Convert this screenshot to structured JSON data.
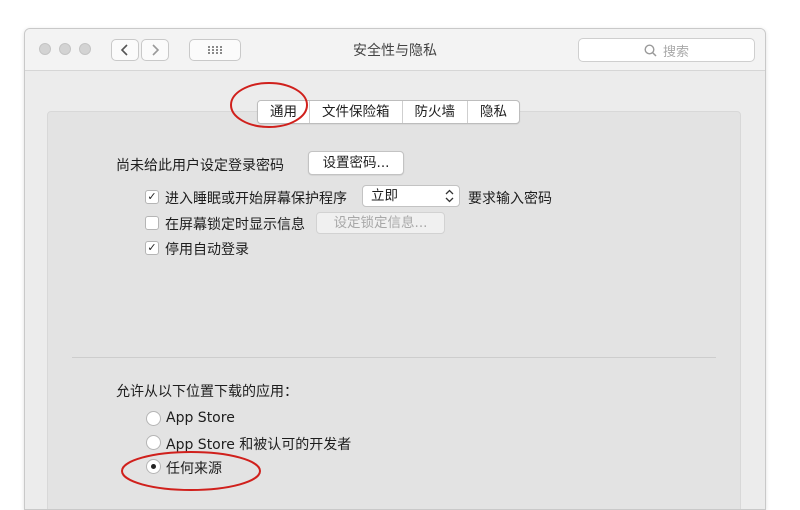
{
  "window": {
    "title": "安全性与隐私"
  },
  "search": {
    "placeholder": "搜索"
  },
  "tabs": [
    {
      "label": "通用",
      "selected": true
    },
    {
      "label": "文件保险箱",
      "selected": false
    },
    {
      "label": "防火墙",
      "selected": false
    },
    {
      "label": "隐私",
      "selected": false
    }
  ],
  "general": {
    "password_notice": "尚未给此用户设定登录密码",
    "set_password_button": "设置密码...",
    "require_password": {
      "checked": true,
      "label": "进入睡眠或开始屏幕保护程序",
      "select_value": "立即",
      "suffix": "要求输入密码"
    },
    "show_message": {
      "checked": false,
      "label": "在屏幕锁定时显示信息",
      "button": "设定锁定信息..."
    },
    "disable_auto_login": {
      "checked": true,
      "label": "停用自动登录"
    }
  },
  "downloads": {
    "heading": "允许从以下位置下载的应用：",
    "options": [
      {
        "label": "App Store",
        "selected": false
      },
      {
        "label": "App Store 和被认可的开发者",
        "selected": false
      },
      {
        "label": "任何来源",
        "selected": true
      }
    ]
  },
  "annotations": {
    "color": "#d0201c"
  }
}
